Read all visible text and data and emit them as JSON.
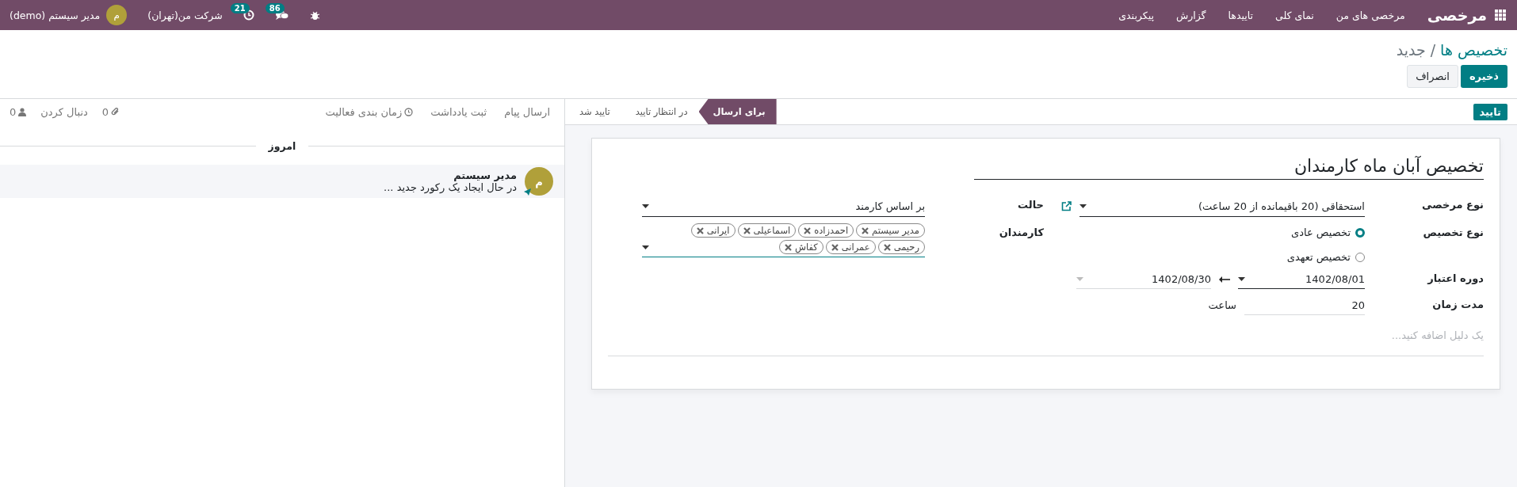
{
  "navbar": {
    "app_name": "مرخصی",
    "menu": [
      "مرخصی های من",
      "نمای کلی",
      "تاییدها",
      "گزارش",
      "پیکربندی"
    ],
    "messages_count": "86",
    "activities_count": "21",
    "company": "شرکت من(تهران)",
    "user_initial": "م",
    "user_name": "مدیر سیستم (demo)"
  },
  "breadcrumb": {
    "parent": "تخصیص ها",
    "separator": "/",
    "current": "جدید"
  },
  "actions": [
    {
      "label": "ذخیره",
      "kind": "primary"
    },
    {
      "label": "انصراف",
      "kind": "secondary"
    }
  ],
  "statusbar": {
    "button": "تایید",
    "steps": [
      {
        "label": "برای ارسال",
        "selected": true
      },
      {
        "label": "در انتظار تایید",
        "selected": false
      },
      {
        "label": "تایید شد",
        "selected": false
      }
    ]
  },
  "form": {
    "title": "تخصیص آبان ماه کارمندان",
    "leave_type": {
      "label": "نوع مرخصی",
      "value": "استحقاقی (20 باقیمانده از 20 ساعت)"
    },
    "allocation_type": {
      "label": "نوع تخصیص",
      "options": [
        {
          "label": "تخصیص عادی",
          "selected": true
        },
        {
          "label": "تخصیص تعهدی",
          "selected": false
        }
      ]
    },
    "validity": {
      "label": "دوره اعتبار",
      "start": "1402/08/01",
      "end": "1402/08/30"
    },
    "duration": {
      "label": "مدت زمان",
      "value": "20",
      "unit": "ساعت"
    },
    "mode": {
      "label": "حالت",
      "value": "بر اساس کارمند"
    },
    "employees": {
      "label": "کارمندان",
      "tags": [
        "مدیر سیستم",
        "احمدزاده",
        "اسماعیلی",
        "ایرانی",
        "رحیمی",
        "عمرانی",
        "کفاش"
      ]
    },
    "reason": {
      "placeholder": "یک دلیل اضافه کنید..."
    }
  },
  "chatter": {
    "send_message": "ارسال پیام",
    "log_note": "ثبت یادداشت",
    "schedule_activity": "زمان بندی فعالیت",
    "attachments_count": "0",
    "follow": "دنبال کردن",
    "followers_count": "0",
    "date_separator": "امروز",
    "messages": [
      {
        "initial": "م",
        "author": "مدیر سیستم",
        "body": "در حال ایجاد یک رکورد جدید ..."
      }
    ]
  }
}
